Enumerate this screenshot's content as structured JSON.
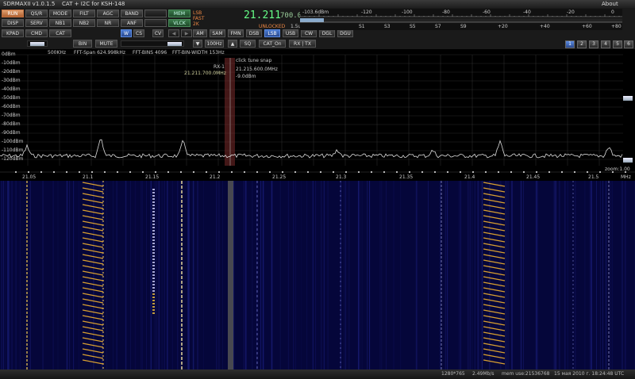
{
  "window": {
    "title": "SDRMAXII v1.0.1.5",
    "subtitle": "CAT  + I2C for  KSH-148",
    "about": "About",
    "minimize": "▫",
    "maximize": "□",
    "close": "✕"
  },
  "buttons": {
    "run": "RUN",
    "qsr": "QS/R",
    "mode": "MODE",
    "filt": "FILT",
    "agc": "AGC",
    "band": "BAND",
    "blank1": "",
    "mem": "MEM",
    "disp": "DISP",
    "serv": "SERV",
    "nb1": "NB1",
    "nb2": "NB2",
    "nr": "NR",
    "anf": "ANF",
    "blank2": "",
    "vlck": "VLCK",
    "kpad": "KPAD",
    "cmd": "CMD",
    "cat": "CAT",
    "w": "W",
    "cs": "CS",
    "cv": "CV",
    "am": "AM",
    "sam": "SAM",
    "fmn": "FMN",
    "dsb": "DSB",
    "lsb": "LSB",
    "usb": "USB",
    "cw": "CW",
    "dgl": "DGL",
    "dgu": "DGU",
    "bin": "BIN",
    "mute": "MUTE",
    "hz100": "100Hz",
    "sq": "SQ",
    "cat_on": "CAT_On",
    "rxtx": "RX | TX",
    "pages": [
      "1",
      "2",
      "3",
      "4",
      "5",
      "6"
    ]
  },
  "vfo": {
    "frequency": "21.211",
    "sub": "700.0",
    "mode": "LSB",
    "agc": "FAST",
    "filter": "2K",
    "lock": "UNLOCKED",
    "level": "1.5uV"
  },
  "smeter": {
    "dbm_labels": [
      "-103.6dBm",
      "-120",
      "-100",
      "-80",
      "-60",
      "-40",
      "-20",
      "0"
    ],
    "s_labels": [
      "S1",
      "S3",
      "S5",
      "S7",
      "S9",
      "+20",
      "+40",
      "+60",
      "+80"
    ],
    "level_dbm": -103.6
  },
  "spectrum": {
    "info_span": "500KHz",
    "info_fft_span": "FFT-Span 624.998kHz",
    "info_bins": "FFT-BINS 4096",
    "info_binwidth": "FFT-BIN-WIDTH 153Hz",
    "rx_label": "RX-1",
    "rx_freq": "21.211.700.0MHz",
    "tune_title": "click tune snap",
    "tune_freq": "21.215.600.0MHz",
    "tune_level": "-9.0dBm",
    "db_labels": [
      "0dBm",
      "-10dBm",
      "-20dBm",
      "-30dBm",
      "-40dBm",
      "-50dBm",
      "-60dBm",
      "-70dBm",
      "-80dBm",
      "-90dBm",
      "-100dBm",
      "-110dBm",
      "-120dBm"
    ],
    "freq_labels": [
      "21.05",
      "21.1",
      "21.15",
      "21.2",
      "21.25",
      "21.3",
      "21.35",
      "21.4",
      "21.45",
      "21.5"
    ],
    "zoom": "zoom:1.00",
    "unit": "MHz"
  },
  "status": {
    "resolution": "1280*765",
    "rate": "2.49Mb/s",
    "mem": "mem use:21536768",
    "datetime": "15 мая 2010 г. 18:24:48 UTC"
  },
  "colors": {
    "run": "#e0a070",
    "accent": "#4a7ad0",
    "frequency": "#66ff88",
    "trace": "#dddddd",
    "waterfall_bg": "#05063a"
  }
}
